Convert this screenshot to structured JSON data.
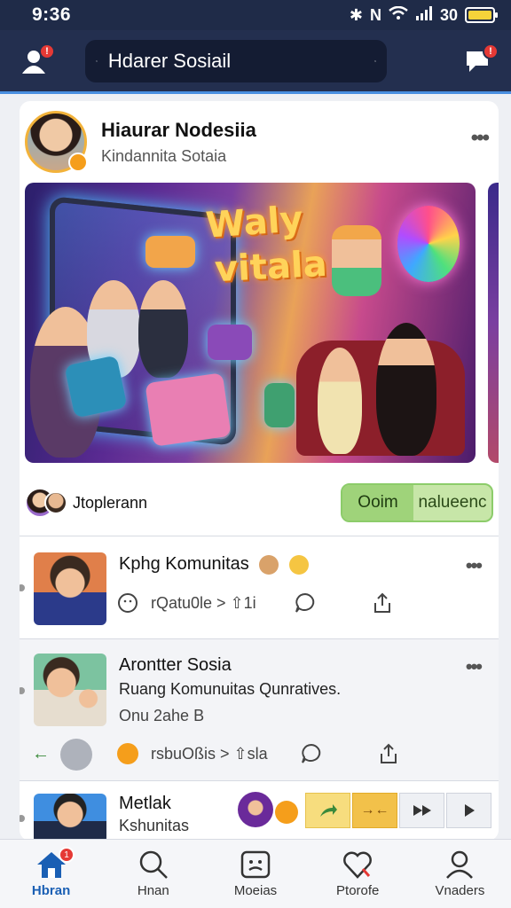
{
  "status_bar": {
    "time": "9:36",
    "network": "30"
  },
  "header": {
    "search_placeholder": "Hdarer Sosiail",
    "profile_icon": "person-icon",
    "chat_icon": "chat-icon"
  },
  "post": {
    "author": "Hiaurar Nodesiia",
    "subtitle": "Kindannita Sotaia",
    "hero_title_line1": "Waly",
    "hero_title_line2": "vitala",
    "participants_label": "Jtoplerann",
    "join_button_left": "Ooim",
    "join_button_right": "nalueenc"
  },
  "feed": [
    {
      "title": "Kphg Komunitas",
      "meta": "rQatu0le > ⇧1i",
      "stats_icon": "smiley-icon"
    },
    {
      "title": "Arontter Sosia",
      "subtitle": "Ruang Komunuitas Qunratives.",
      "time": "Onu 2ahe Β",
      "meta": "rsbuOßis > ⇧sla"
    },
    {
      "title": "Metlak",
      "subtitle": "Kshunitas"
    }
  ],
  "bottom_nav": [
    {
      "label": "Hbran",
      "icon": "home-icon",
      "active": true
    },
    {
      "label": "Hnan",
      "icon": "search-icon",
      "active": false
    },
    {
      "label": "Moeias",
      "icon": "media-icon",
      "active": false
    },
    {
      "label": "Ptorofe",
      "icon": "heart-icon",
      "active": false
    },
    {
      "label": "Vnaders",
      "icon": "profile-icon",
      "active": false
    }
  ],
  "colors": {
    "header_bg": "#232f4f",
    "accent_blue": "#1a5fb4",
    "badge_red": "#e53935",
    "join_green": "#9fd37a"
  }
}
